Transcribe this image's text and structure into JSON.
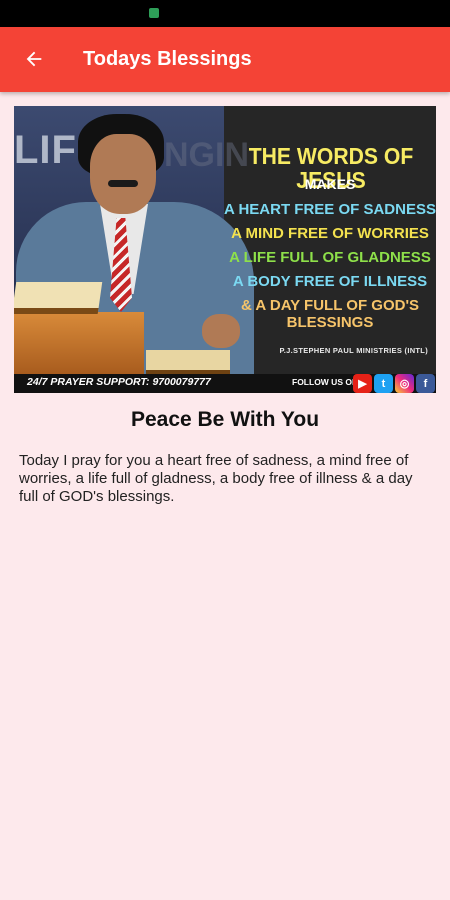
{
  "app_bar": {
    "title": "Todays Blessings",
    "color": "#f44336",
    "back_icon": "arrow-left-icon"
  },
  "banner": {
    "background_word_1": "LIFE",
    "background_word_2": "NGIN",
    "headline": "THE WORDS OF JESUS",
    "makes": "MAKES",
    "lines": [
      "A HEART FREE OF SADNESS",
      "A MIND FREE OF WORRIES",
      "A LIFE FULL OF GLADNESS",
      "A BODY FREE OF ILLNESS",
      "& A DAY FULL OF GOD'S BLESSINGS"
    ],
    "ministry": "P.J.STEPHEN PAUL MINISTRIES (INTL)",
    "prayer_support": "24/7 PRAYER SUPPORT: 9700079777",
    "follow_label": "FOLLOW US ON:",
    "social_icons": [
      "youtube-icon",
      "twitter-icon",
      "instagram-icon",
      "facebook-icon"
    ]
  },
  "post": {
    "title": "Peace Be With You",
    "body": "Today I pray for you a heart free of sadness, a mind free of worries, a life full of gladness, a body free of illness & a day full of GOD's blessings."
  }
}
